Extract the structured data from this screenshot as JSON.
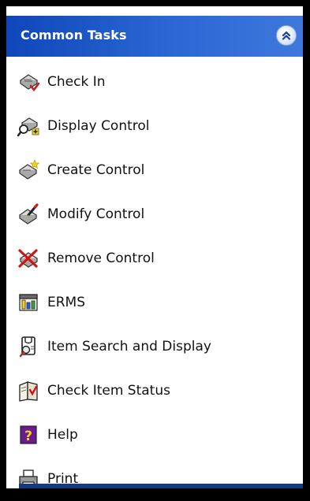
{
  "panel": {
    "title": "Common Tasks",
    "collapse_icon": "chevron-double-up-icon",
    "header_colors": {
      "start": "#0f47b8",
      "end": "#3e78dc",
      "text": "#ffffff"
    }
  },
  "tasks": [
    {
      "label": "Check In",
      "icon": "check-in-icon"
    },
    {
      "label": "Display Control",
      "icon": "display-control-icon"
    },
    {
      "label": "Create Control",
      "icon": "create-control-icon"
    },
    {
      "label": "Modify Control",
      "icon": "modify-control-icon"
    },
    {
      "label": "Remove Control",
      "icon": "remove-control-icon"
    },
    {
      "label": "ERMS",
      "icon": "erms-icon"
    },
    {
      "label": "Item Search and Display",
      "icon": "item-search-icon"
    },
    {
      "label": "Check Item Status",
      "icon": "check-item-status-icon"
    },
    {
      "label": "Help",
      "icon": "help-icon"
    },
    {
      "label": "Print",
      "icon": "print-icon"
    }
  ]
}
